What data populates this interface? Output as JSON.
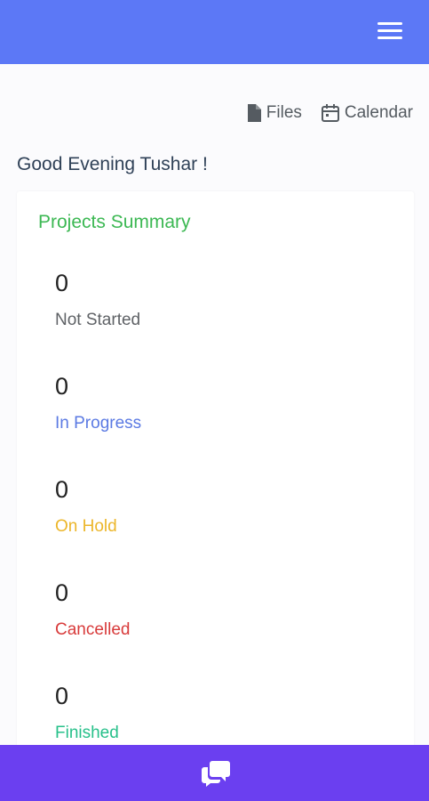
{
  "header": {
    "menu_icon": "hamburger-menu-icon",
    "background_color": "#5c78f6"
  },
  "quick_links": {
    "files": {
      "label": "Files",
      "icon": "file-icon"
    },
    "calendar": {
      "label": "Calendar",
      "icon": "calendar-icon"
    }
  },
  "greeting": "Good Evening Tushar !",
  "projects_summary": {
    "title": "Projects Summary",
    "title_color": "#3cb853",
    "stats": [
      {
        "count": "0",
        "label": "Not Started",
        "color": "#5f6266"
      },
      {
        "count": "0",
        "label": "In Progress",
        "color": "#5b7ae3"
      },
      {
        "count": "0",
        "label": "On Hold",
        "color": "#ecb62a"
      },
      {
        "count": "0",
        "label": "Cancelled",
        "color": "#d83b3b"
      },
      {
        "count": "0",
        "label": "Finished",
        "color": "#27c08a"
      }
    ]
  },
  "footer": {
    "chat_icon": "chat-bubbles-icon",
    "background_color": "#6b3ff0"
  }
}
